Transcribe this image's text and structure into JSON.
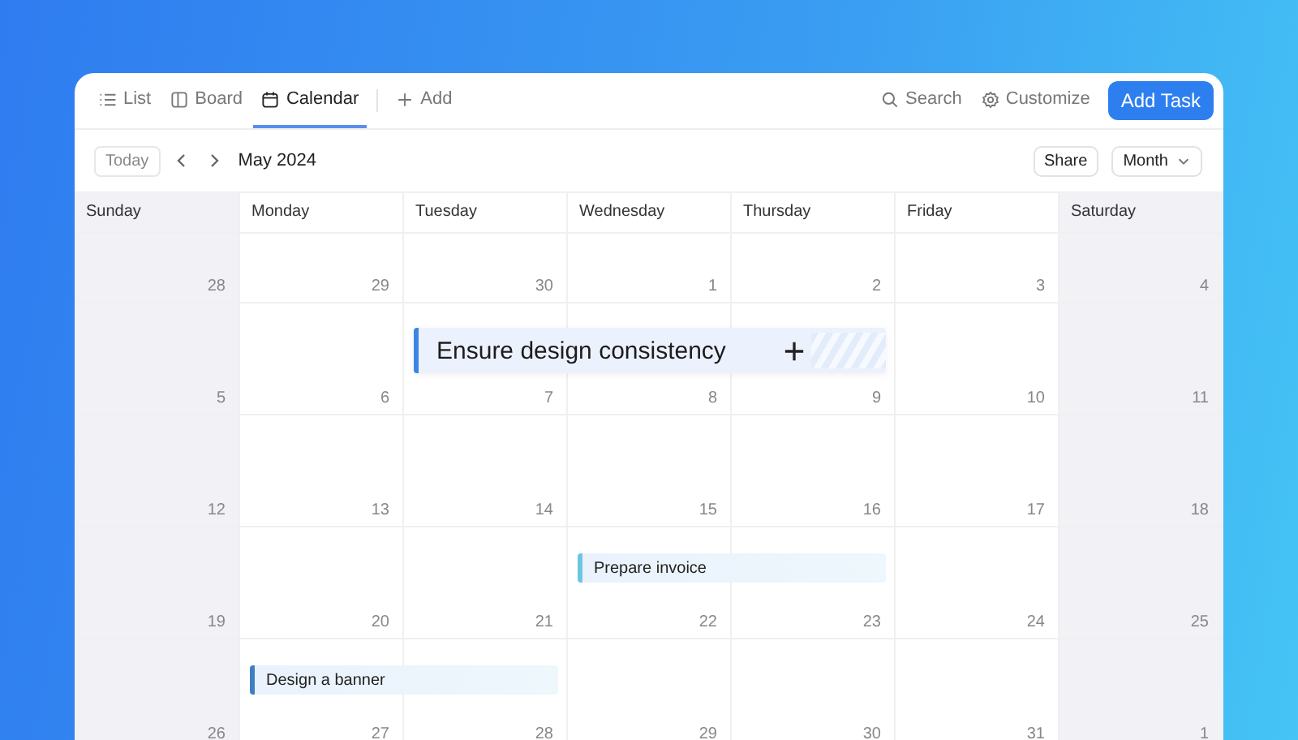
{
  "tabs": [
    {
      "label": "List",
      "selected": false
    },
    {
      "label": "Board",
      "selected": false
    },
    {
      "label": "Calendar",
      "selected": true
    }
  ],
  "add_view": {
    "label": "Add"
  },
  "actions": {
    "search": "Search",
    "customize": "Customize",
    "add_task": "Add Task"
  },
  "toolbar": {
    "today": "Today",
    "month_label": "May 2024",
    "share": "Share",
    "view_select": "Month"
  },
  "columns": [
    {
      "label": "Sunday",
      "weekend": true
    },
    {
      "label": "Monday",
      "weekend": false
    },
    {
      "label": "Tuesday",
      "weekend": false
    },
    {
      "label": "Wednesday",
      "weekend": false
    },
    {
      "label": "Thursday",
      "weekend": false
    },
    {
      "label": "Friday",
      "weekend": false
    },
    {
      "label": "Saturday",
      "weekend": true
    }
  ],
  "weeks": [
    {
      "days": [
        {
          "date": "28"
        },
        {
          "date": "29"
        },
        {
          "date": "30"
        },
        {
          "date": "1"
        },
        {
          "date": "2"
        },
        {
          "date": "3"
        },
        {
          "date": "4"
        }
      ]
    },
    {
      "days": [
        {
          "date": "5"
        },
        {
          "date": "6"
        },
        {
          "date": "7",
          "event": {
            "title": "Ensure design consistency",
            "kind": "dragging"
          }
        },
        {
          "date": "8",
          "event_continues": true
        },
        {
          "date": "9",
          "event_continues": true
        },
        {
          "date": "10"
        },
        {
          "date": "11"
        }
      ]
    },
    {
      "days": [
        {
          "date": "12"
        },
        {
          "date": "13"
        },
        {
          "date": "14"
        },
        {
          "date": "15"
        },
        {
          "date": "16"
        },
        {
          "date": "17"
        },
        {
          "date": "18"
        }
      ]
    },
    {
      "days": [
        {
          "date": "19"
        },
        {
          "date": "20"
        },
        {
          "date": "21"
        },
        {
          "date": "22",
          "event": {
            "title": "Prepare invoice",
            "kind": "task",
            "color": "#6cc7de"
          }
        },
        {
          "date": "23",
          "event_continues": true
        },
        {
          "date": "24"
        },
        {
          "date": "25"
        }
      ]
    },
    {
      "days": [
        {
          "date": "26"
        },
        {
          "date": "27",
          "event": {
            "title": "Design a banner",
            "kind": "task",
            "color": "#3f7fbf"
          }
        },
        {
          "date": "28",
          "event_continues": true
        },
        {
          "date": "29"
        },
        {
          "date": "30"
        },
        {
          "date": "31"
        },
        {
          "date": "1"
        }
      ]
    }
  ]
}
